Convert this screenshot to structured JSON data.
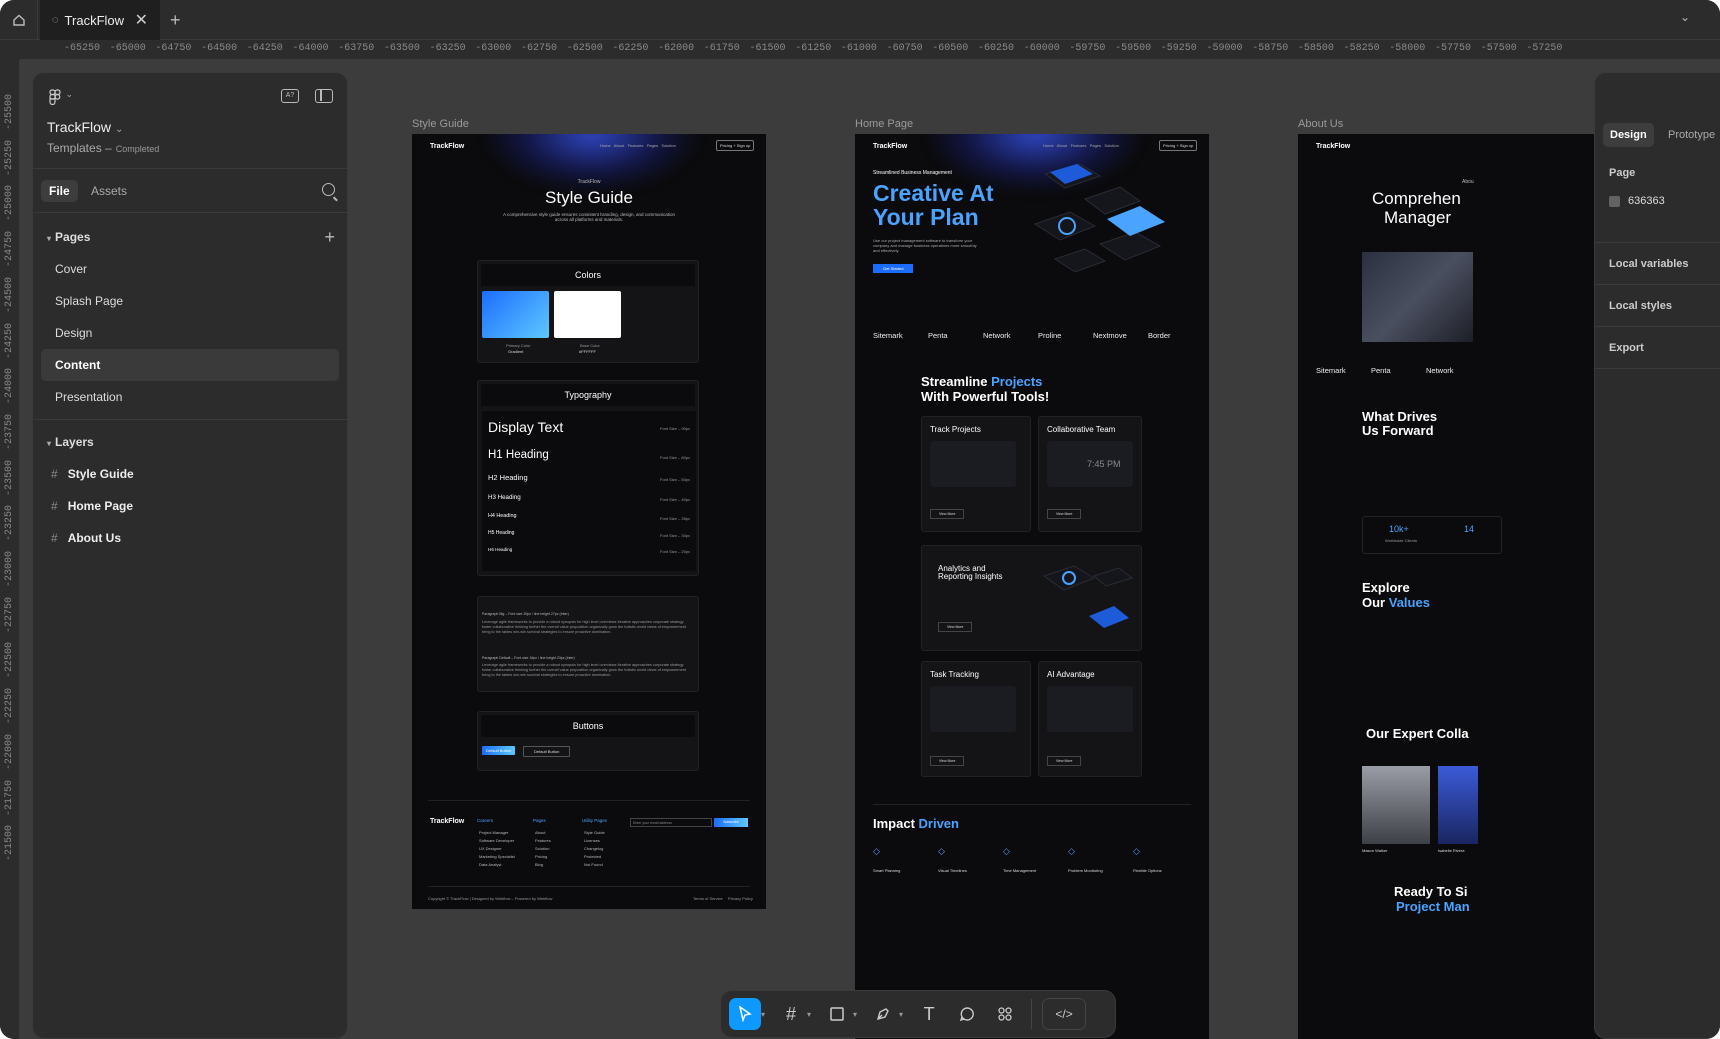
{
  "tabs": {
    "file_name": "TrackFlow",
    "close": "✕",
    "add": "+",
    "caret": "⌄"
  },
  "ruler": {
    "h": [
      "-65250",
      "-65000",
      "-64750",
      "-64500",
      "-64250",
      "-64000",
      "-63750",
      "-63500",
      "-63250",
      "-63000",
      "-62750",
      "-62500",
      "-62250",
      "-62000",
      "-61750",
      "-61500",
      "-61250",
      "-61000",
      "-60750",
      "-60500",
      "-60250",
      "-60000",
      "-59750",
      "-59500",
      "-59250",
      "-59000",
      "-58750",
      "-58500",
      "-58250",
      "-58000",
      "-57750",
      "-57500",
      "-57250"
    ],
    "v": [
      "-25500",
      "-25250",
      "-25000",
      "-24750",
      "-24500",
      "-24250",
      "-24000",
      "-23750",
      "-23500",
      "-23250",
      "-23000",
      "-22750",
      "-22500",
      "-22250",
      "-22000",
      "-21750",
      "-21500"
    ]
  },
  "left_panel": {
    "file_title": "TrackFlow",
    "caret": "⌄",
    "project": "Templates",
    "dash": "–",
    "status": "Completed",
    "tab_file": "File",
    "tab_assets": "Assets",
    "pages_heading": "Pages",
    "pages": [
      "Cover",
      "Splash Page",
      "Design",
      "Content",
      "Presentation"
    ],
    "selected_page": "Content",
    "layers_heading": "Layers",
    "layers": [
      "Style Guide",
      "Home Page",
      "About Us"
    ]
  },
  "frames": {
    "style_guide": {
      "label": "Style Guide",
      "brand": "TrackFlow",
      "kicker": "TrackFlow",
      "title": "Style Guide",
      "subtitle": "A comprehensive style guide ensures consistent branding, design, and communication across all platforms and materials.",
      "colors_heading": "Colors",
      "swatch1_label": "Primary Color",
      "swatch1_value": "Gradient",
      "swatch2_label": "Base Color",
      "swatch2_value": "#FFFFFF",
      "typography_heading": "Typography",
      "type_rows": [
        {
          "name": "Display Text",
          "spec": "Font Size – 90px"
        },
        {
          "name": "H1 Heading",
          "spec": "Font Size – 80px"
        },
        {
          "name": "H2 Heading",
          "spec": "Font Size – 50px"
        },
        {
          "name": "H3 Heading",
          "spec": "Font Size – 40px"
        },
        {
          "name": "H4 Heading",
          "spec": "Font Size – 35px"
        },
        {
          "name": "H5 Heading",
          "spec": "Font Size – 30px"
        },
        {
          "name": "H6 Heading",
          "spec": "Font Size – 20px"
        }
      ],
      "para_big_label": "Paragraph Big – Font size 20px / line height 27px (Inter)",
      "para_big": "Leverage agile frameworks to provide a robust synopsis for high level overviews Iterative approaches corporate strategy foster collaborative thinking further the overall value proposition organically grow the holistic world views of empowerment bring to the tables win-win survival strategies to ensure proactive domination.",
      "para_default_label": "Paragraph Default – Font size 16px / line height 23px (Inter)",
      "para_default": "Leverage agile frameworks to provide a robust synopsis for high level overviews Iterative approaches corporate strategy foster collaborative thinking further the overall value proposition organically grow the holistic world views of empowerment bring to the tables win-win survival strategies to ensure proactive domination.",
      "buttons_heading": "Buttons",
      "btn1": "Default Button",
      "btn2": "Default Button",
      "footer_cols": [
        {
          "title": "Careers",
          "items": [
            "Project Manager",
            "Software Developer",
            "UX Designer",
            "Marketing Specialist",
            "Data Analyst"
          ]
        },
        {
          "title": "Pages",
          "items": [
            "About",
            "Features",
            "Solution",
            "Pricing",
            "Blog"
          ]
        },
        {
          "title": "Utility Pages",
          "items": [
            "Style Guide",
            "Licenses",
            "Changelog",
            "Protected",
            "Not Found"
          ]
        }
      ],
      "email_placeholder": "Enter your email address",
      "subscribe": "Subscribe",
      "copyright": "Copyright © TrackFlow | Designed by Webflow – Powered by Webflow",
      "terms": "Terms of Service",
      "privacy": "Privacy Policy"
    },
    "home": {
      "label": "Home Page",
      "brand": "TrackFlow",
      "kicker": "Streamlined Business Management",
      "hero1": "Creative At",
      "hero2": "Your Plan",
      "hero_text": "Use our project management software to transform your company and manage business operations more smoothly and effectively.",
      "cta": "Get Started",
      "logos": [
        "Sitemark",
        "Penta",
        "Network",
        "Proline",
        "Nextmove",
        "Border"
      ],
      "section_title_a": "Streamline ",
      "section_title_b": "Projects",
      "section_title_c": "With Powerful Tools!",
      "card1": "Track Projects",
      "card2": "Collaborative Team",
      "clock": "7:45 PM",
      "card3a": "Analytics and",
      "card3b": "Reporting Insights",
      "card4": "Task Tracking",
      "card5": "AI Advantage",
      "view_more": "View More",
      "impact_a": "Impact ",
      "impact_b": "Driven",
      "impact_items": [
        "Smart Planning",
        "Visual Timelines",
        "Time Management",
        "Problem Monitoring",
        "Flexible Options"
      ]
    },
    "about": {
      "label": "About Us",
      "brand": "TrackFlow",
      "kicker": "Abou",
      "title1": "Comprehen",
      "title2": "Manager",
      "logos": [
        "Sitemark",
        "Penta",
        "Network"
      ],
      "drives1": "What Drives",
      "drives2": "Us Forward",
      "stat1": "10k+",
      "stat1_label": "Worldwide Clients",
      "stat2": "14",
      "explore1": "Explore",
      "explore2a": "Our ",
      "explore2b": "Values",
      "expert": "Our Expert Colla",
      "person1": "Mason Walker",
      "person2": "Isabelle Rivera",
      "ready1": "Ready To Si",
      "ready2": "Project Man"
    }
  },
  "right_panel": {
    "tab_design": "Design",
    "tab_prototype": "Prototype",
    "page_heading": "Page",
    "page_color": "636363",
    "local_variables": "Local variables",
    "local_styles": "Local styles",
    "export": "Export"
  },
  "colors": {
    "accent": "#0d99ff",
    "canvas": "#3c3c3c",
    "panel": "#2c2c2c",
    "page_bg": "#636363"
  }
}
